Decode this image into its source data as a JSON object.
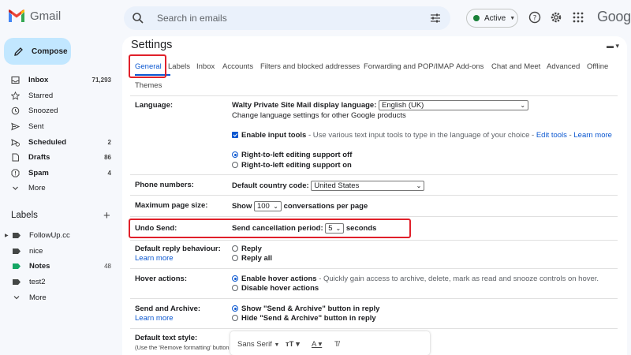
{
  "header": {
    "app_name": "Gmail",
    "search_placeholder": "Search in emails",
    "status": "Active",
    "google_word": "Google"
  },
  "sidebar": {
    "compose_label": "Compose",
    "items": [
      {
        "label": "Inbox",
        "count": "71,293",
        "icon": "inbox-icon",
        "bold": true
      },
      {
        "label": "Starred",
        "count": "",
        "icon": "star-icon",
        "bold": false
      },
      {
        "label": "Snoozed",
        "count": "",
        "icon": "clock-icon",
        "bold": false
      },
      {
        "label": "Sent",
        "count": "",
        "icon": "send-icon",
        "bold": false
      },
      {
        "label": "Scheduled",
        "count": "2",
        "icon": "scheduled-icon",
        "bold": true
      },
      {
        "label": "Drafts",
        "count": "86",
        "icon": "draft-icon",
        "bold": true
      },
      {
        "label": "Spam",
        "count": "4",
        "icon": "spam-icon",
        "bold": true
      },
      {
        "label": "More",
        "count": "",
        "icon": "chevron-down-icon",
        "bold": false
      }
    ],
    "labels_heading": "Labels",
    "labels": [
      {
        "label": "FollowUp.cc",
        "count": "",
        "caret": true,
        "color": "#444746"
      },
      {
        "label": "nice",
        "count": "",
        "caret": false,
        "color": "#444746"
      },
      {
        "label": "Notes",
        "count": "48",
        "caret": false,
        "color": "#16a765",
        "bold": true
      },
      {
        "label": "test2",
        "count": "",
        "caret": false,
        "color": "#444746"
      },
      {
        "label": "More",
        "count": "",
        "caret": false,
        "more": true
      }
    ]
  },
  "settings": {
    "title": "Settings",
    "tabs": [
      "General",
      "Labels",
      "Inbox",
      "Accounts",
      "Filters and blocked addresses",
      "Forwarding and POP/IMAP",
      "Add-ons",
      "Chat and Meet",
      "Advanced",
      "Offline",
      "Themes"
    ],
    "language": {
      "label": "Language:",
      "display_label": "Walty Private Site Mail display language:",
      "display_value": "English (UK)",
      "change_link": "Change language settings for other Google products",
      "input_tools_label": "Enable input tools",
      "input_tools_desc": " - Use various text input tools to type in the language of your choice - ",
      "edit_tools": "Edit tools",
      "dash": " - ",
      "learn_more": "Learn more",
      "rtl_off": "Right-to-left editing support off",
      "rtl_on": "Right-to-left editing support on"
    },
    "phone": {
      "label": "Phone numbers:",
      "country_label": "Default country code:",
      "country_value": "United States"
    },
    "page_size": {
      "label": "Maximum page size:",
      "show": "Show",
      "value": "100",
      "suffix": "conversations per page"
    },
    "undo_send": {
      "label": "Undo Send:",
      "period_label": "Send cancellation period:",
      "value": "5",
      "suffix": "seconds"
    },
    "reply": {
      "label": "Default reply behaviour:",
      "learn_more": "Learn more",
      "opt1": "Reply",
      "opt2": "Reply all"
    },
    "hover": {
      "label": "Hover actions:",
      "opt1": "Enable hover actions",
      "opt1_desc": " - Quickly gain access to archive, delete, mark as read and snooze controls on hover.",
      "opt2": "Disable hover actions"
    },
    "send_archive": {
      "label": "Send and Archive:",
      "learn_more": "Learn more",
      "opt1": "Show \"Send & Archive\" button in reply",
      "opt2": "Hide \"Send & Archive\" button in reply"
    },
    "text_style": {
      "label": "Default text style:",
      "sub": "(Use the 'Remove formatting' button",
      "font": "Sans Serif"
    }
  },
  "colors": {
    "accent": "#0b57d0",
    "highlight": "#e0202a",
    "compose_bg": "#c2e7ff"
  }
}
